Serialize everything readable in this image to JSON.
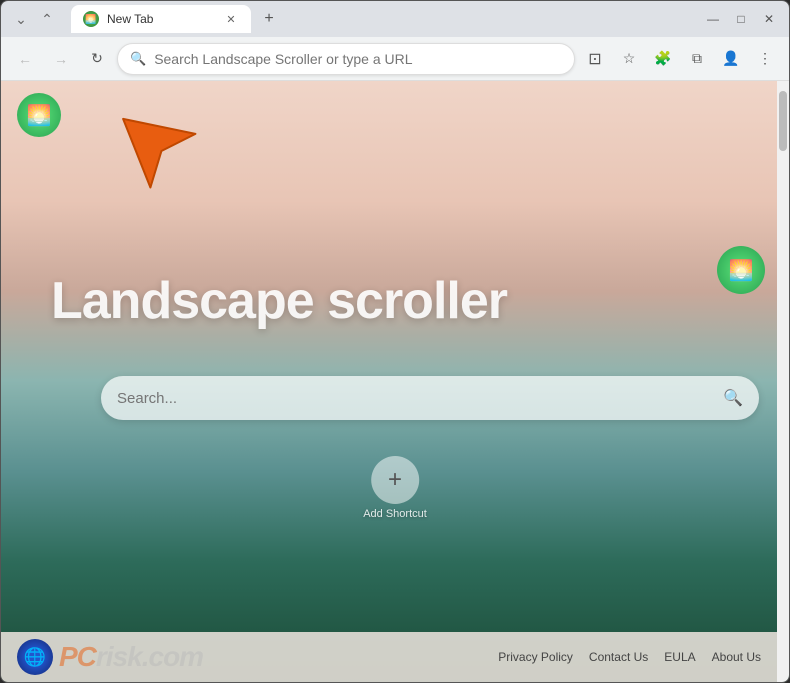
{
  "window": {
    "title": "New Tab",
    "controls": {
      "minimize": "—",
      "maximize": "□",
      "close": "✕",
      "chevron_down": "⌄",
      "chevron_up": "⌃"
    }
  },
  "titlebar": {
    "tab_label": "New Tab",
    "new_tab_icon": "+"
  },
  "navbar": {
    "back_icon": "←",
    "forward_icon": "→",
    "reload_icon": "↻",
    "address_placeholder": "Search Landscape Scroller or type a URL",
    "cast_icon": "⊡",
    "bookmark_icon": "☆",
    "extensions_icon": "⊕",
    "split_icon": "⧉",
    "profile_icon": "👤",
    "menu_icon": "⋮"
  },
  "page": {
    "main_title": "Landscape scroller",
    "search_placeholder": "Search...",
    "add_shortcut_label": "Add Shortcut",
    "logo_emoji": "🌅"
  },
  "footer": {
    "brand_text": "PC",
    "brand_suffix": "risk.com",
    "links": [
      {
        "label": "Privacy Policy",
        "id": "privacy-policy"
      },
      {
        "label": "Contact Us",
        "id": "contact-us"
      },
      {
        "label": "EULA",
        "id": "eula"
      },
      {
        "label": "About Us",
        "id": "about-us"
      }
    ]
  },
  "arrow": {
    "symbol": "➤"
  }
}
